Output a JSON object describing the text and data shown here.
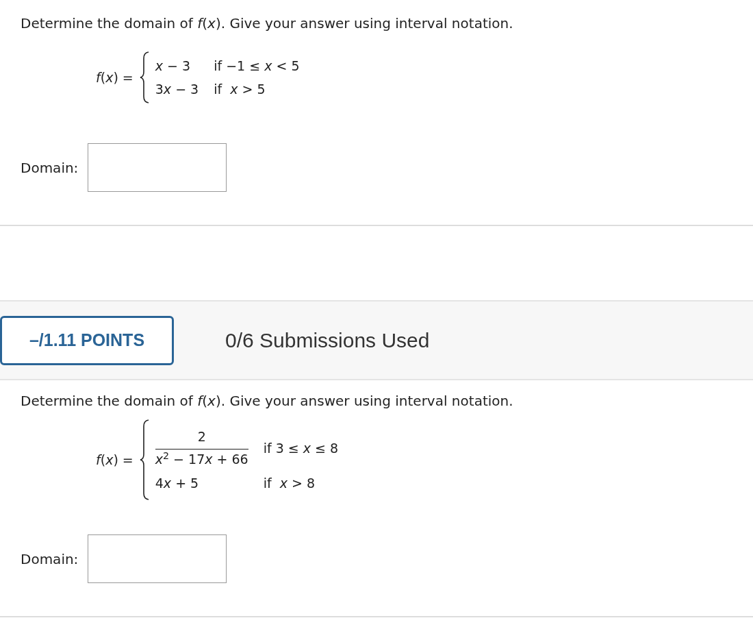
{
  "questions": [
    {
      "prompt": "Determine the domain of *f*(*x*). Give your answer using interval notation.",
      "function_label": "*f*(*x*) =",
      "cases": [
        {
          "kind": "expression",
          "expression": "x − 3",
          "condition": "if −1 ≤ *x* < 5"
        },
        {
          "kind": "expression",
          "expression": "3x − 3",
          "condition": "if  *x* > 5"
        }
      ],
      "answer": {
        "label": "Domain:"
      }
    },
    {
      "header": {
        "points": "–/1.11 POINTS",
        "submissions": "0/6 Submissions Used"
      },
      "prompt": "Determine the domain of *f*(*x*). Give your answer using interval notation.",
      "function_label": "*f*(*x*) =",
      "cases": [
        {
          "kind": "fraction",
          "numerator": "2",
          "denominator": "x$^{2}$ − 17x + 66",
          "condition": "if 3 ≤ *x* ≤ 8"
        },
        {
          "kind": "expression",
          "expression": "4x + 5",
          "condition": "if  *x* > 8"
        }
      ],
      "answer": {
        "label": "Domain:"
      }
    }
  ]
}
